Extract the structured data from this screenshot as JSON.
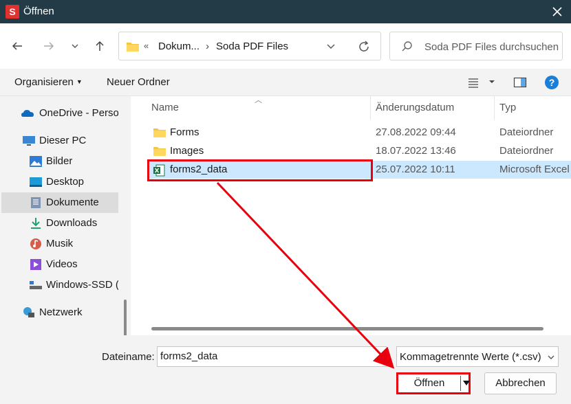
{
  "window": {
    "title": "Öffnen",
    "app_icon_letter": "S",
    "accent": "#233b47"
  },
  "address": {
    "overflow": "«",
    "crumbs": [
      "Dokum...",
      "Soda PDF Files"
    ],
    "separator": "›"
  },
  "search": {
    "placeholder": "Soda PDF Files durchsuchen"
  },
  "toolbar": {
    "organize": "Organisieren",
    "new_folder": "Neuer Ordner"
  },
  "sidebar": {
    "items": [
      {
        "label": "OneDrive - Persor",
        "icon": "onedrive-icon"
      },
      {
        "label": "Dieser PC",
        "icon": "pc-icon"
      },
      {
        "label": "Bilder",
        "icon": "pictures-icon"
      },
      {
        "label": "Desktop",
        "icon": "desktop-icon"
      },
      {
        "label": "Dokumente",
        "icon": "documents-icon",
        "selected": true
      },
      {
        "label": "Downloads",
        "icon": "downloads-icon"
      },
      {
        "label": "Musik",
        "icon": "music-icon"
      },
      {
        "label": "Videos",
        "icon": "videos-icon"
      },
      {
        "label": "Windows-SSD (C",
        "icon": "drive-icon"
      },
      {
        "label": "Netzwerk",
        "icon": "network-icon"
      }
    ]
  },
  "filelist": {
    "columns": [
      "Name",
      "Änderungsdatum",
      "Typ"
    ],
    "rows": [
      {
        "name": "Forms",
        "date": "27.08.2022 09:44",
        "type": "Dateiordner",
        "icon": "folder-icon"
      },
      {
        "name": "Images",
        "date": "18.07.2022 13:46",
        "type": "Dateiordner",
        "icon": "folder-icon"
      },
      {
        "name": "forms2_data",
        "date": "25.07.2022 10:11",
        "type": "Microsoft Excel",
        "icon": "excel-icon",
        "selected": true
      }
    ]
  },
  "footer": {
    "filename_label": "Dateiname:",
    "filename_value": "forms2_data",
    "filetype": "Kommagetrennte Werte (*.csv)",
    "open": "Öffnen",
    "cancel": "Abbrechen"
  },
  "colors": {
    "highlight": "#e8000d",
    "selection": "#cce8ff",
    "help": "#1a7fd6"
  }
}
